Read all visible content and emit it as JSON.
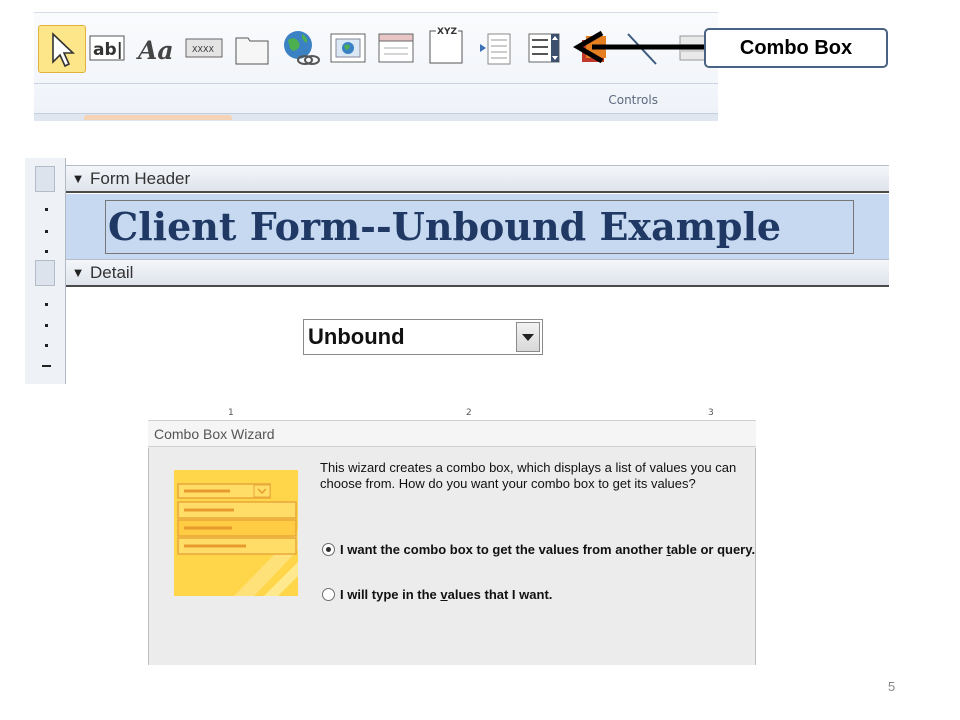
{
  "ribbon": {
    "group_label": "Controls",
    "tools": [
      {
        "icon": "select-pointer-icon"
      },
      {
        "icon": "text-box-icon",
        "label": "ab|"
      },
      {
        "icon": "label-icon",
        "label": "Aa"
      },
      {
        "icon": "button-icon",
        "label": "XXXX"
      },
      {
        "icon": "tab-control-icon"
      },
      {
        "icon": "hyperlink-icon"
      },
      {
        "icon": "web-browser-control-icon"
      },
      {
        "icon": "navigation-control-icon"
      },
      {
        "icon": "option-group-icon",
        "label": "XYZ"
      },
      {
        "icon": "insert-page-break-icon"
      },
      {
        "icon": "combo-box-icon"
      },
      {
        "icon": "chart-icon"
      },
      {
        "icon": "line-icon"
      },
      {
        "icon": "toggle-button-icon"
      }
    ]
  },
  "callout": {
    "label": "Combo Box"
  },
  "design": {
    "form_header_label": "Form Header",
    "form_title": "Client Form--Unbound Example",
    "detail_label": "Detail",
    "combo_value": "Unbound"
  },
  "wizard": {
    "title": "Combo Box Wizard",
    "description": "This wizard creates a combo box, which displays a list of values you can choose from.  How do you want your combo box to get its values?",
    "options": [
      {
        "pre": "I want the combo box to get the values from another ",
        "u": "t",
        "post": "able or query.",
        "selected": true
      },
      {
        "pre": "I will type in the ",
        "u": "v",
        "post": "alues that I want.",
        "selected": false
      }
    ],
    "ruler_marks": [
      "1",
      "2",
      "3"
    ]
  },
  "page_number": "5",
  "colors": {
    "accent": "#1f3864",
    "header_fill": "#c6d9f0",
    "selected_tool": "#fde68a"
  }
}
